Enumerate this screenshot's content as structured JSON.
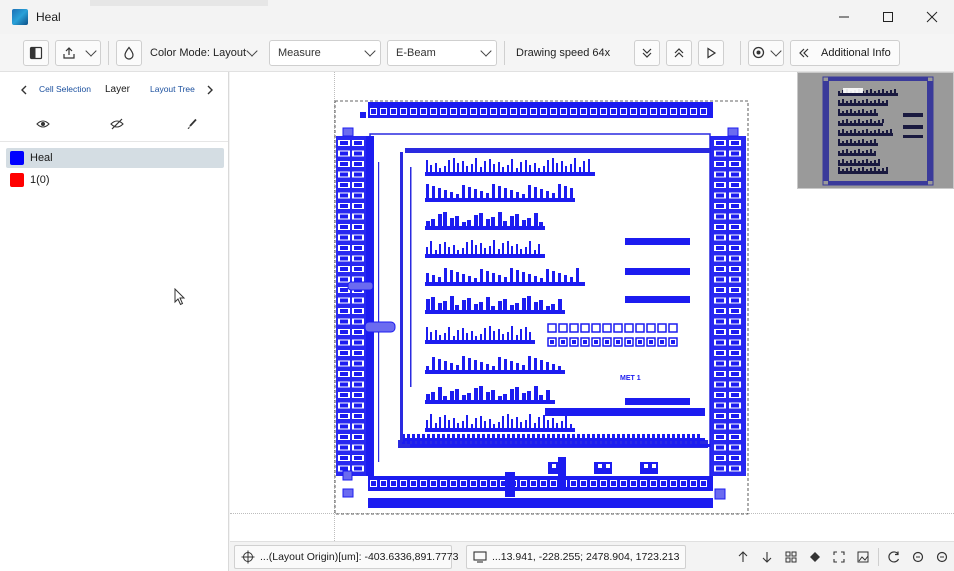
{
  "window": {
    "title": "Heal",
    "icon": "app-icon",
    "minimize_icon": "minimize-icon",
    "maximize_icon": "maximize-icon",
    "close_icon": "close-icon"
  },
  "toolbar": {
    "color_mode": "Color Mode: Layout",
    "measure": "Measure",
    "beam": "E-Beam",
    "drawing_speed": "Drawing speed 64x",
    "additional_info": "Additional Info"
  },
  "left_panel": {
    "tabs": {
      "cell_selection": "Cell Selection",
      "layer": "Layer",
      "layout_tree": "Layout Tree"
    },
    "layers": [
      {
        "name": "Heal",
        "color": "#0000ff",
        "selected": true
      },
      {
        "name": "1(0)",
        "color": "#ff0000",
        "selected": false
      }
    ]
  },
  "canvas": {
    "layout_color": "#1c1cf0",
    "label_text": "MET 1"
  },
  "status": {
    "origin": "...(Layout Origin)[um]: -403.6336,891.7773",
    "bbox": "...13.941, -228.255; 2478.904, 1723.213"
  },
  "colors": {
    "accent": "#2a2ae0",
    "minimap_bg": "#9a9a9a"
  }
}
